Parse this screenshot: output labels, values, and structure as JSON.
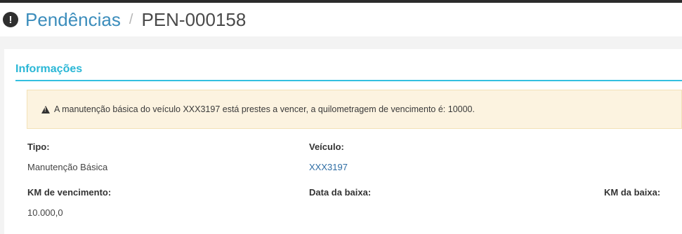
{
  "header": {
    "icon": "exclamation-circle-icon",
    "breadcrumb_root": "Pendências",
    "breadcrumb_sep": "/",
    "breadcrumb_current": "PEN-000158"
  },
  "section": {
    "title": "Informações"
  },
  "warning": {
    "icon": "warning-triangle-icon",
    "text": "A manutenção básica do veículo XXX3197 está prestes a vencer, a quilometragem de vencimento é: 10000."
  },
  "fields": {
    "tipo": {
      "label": "Tipo:",
      "value": "Manutenção Básica"
    },
    "veiculo": {
      "label": "Veículo:",
      "value": "XXX3197"
    },
    "km_vencimento": {
      "label": "KM de vencimento:",
      "value": "10.000,0"
    },
    "data_baixa": {
      "label": "Data da baixa:",
      "value": ""
    },
    "km_baixa": {
      "label": "KM da baixa:",
      "value": ""
    }
  },
  "colors": {
    "accent": "#2ab7d6",
    "link": "#2e6da4",
    "warning_bg": "#fcf3e0"
  }
}
